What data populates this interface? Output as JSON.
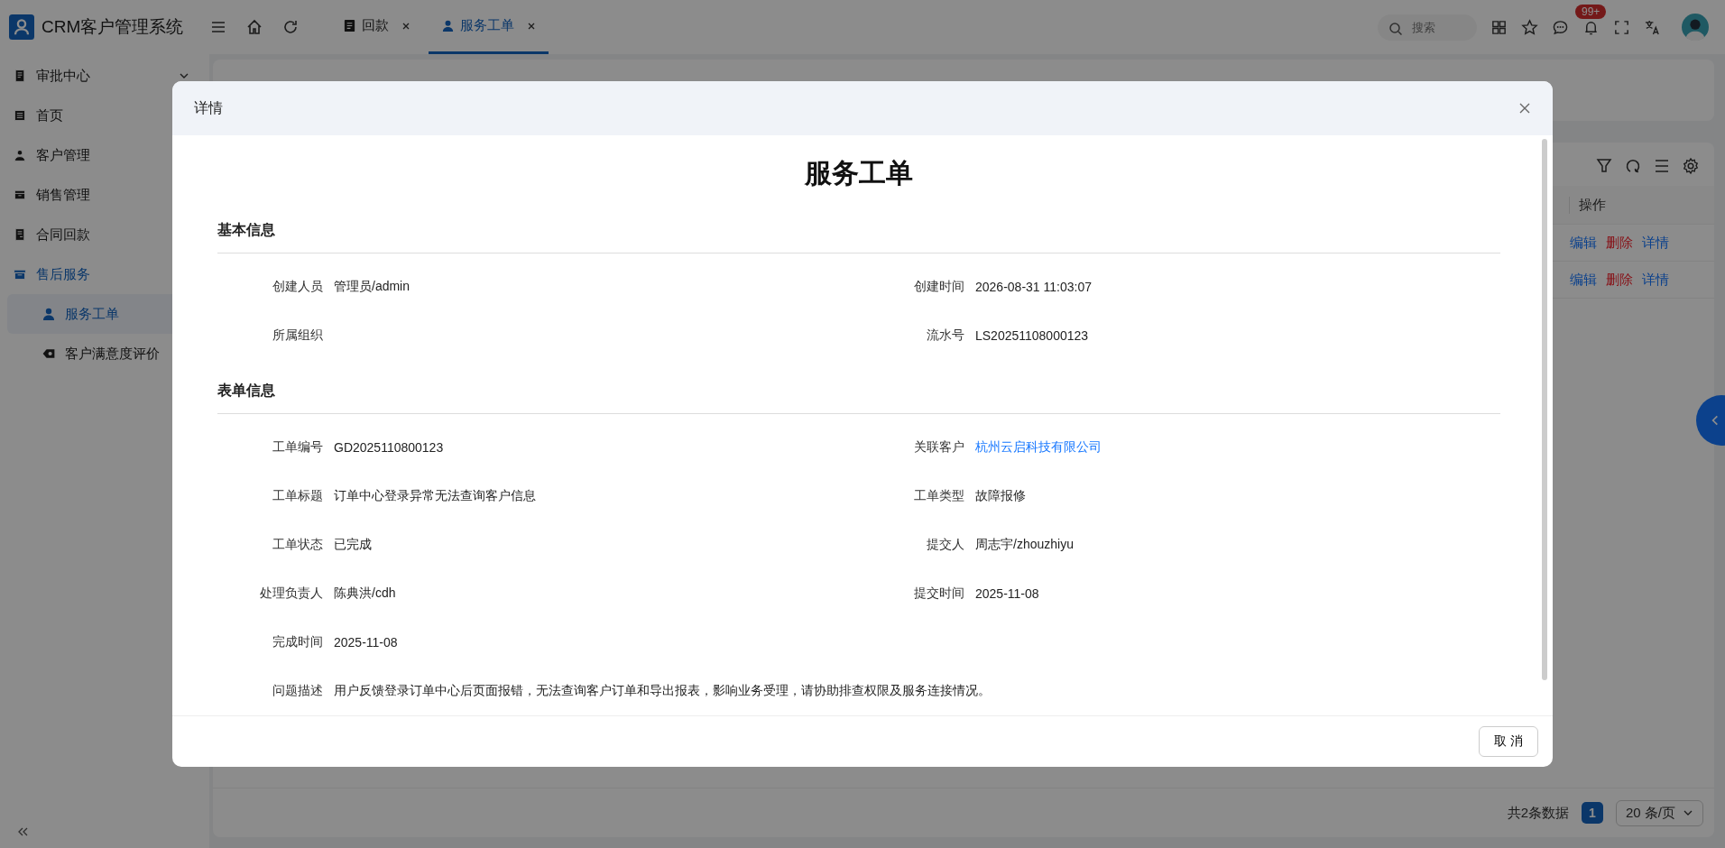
{
  "app": {
    "title": "CRM客户管理系统"
  },
  "tabs": [
    {
      "label": "回款",
      "selected": false
    },
    {
      "label": "服务工单",
      "selected": true
    }
  ],
  "header": {
    "search": {
      "placeholder": "搜索"
    },
    "notification_badge": "99+"
  },
  "sidebar": {
    "items": [
      {
        "label": "审批中心",
        "expanded": false,
        "selected": false
      },
      {
        "label": "首页",
        "selected": false
      },
      {
        "label": "客户管理",
        "selected": false
      },
      {
        "label": "销售管理",
        "selected": false
      },
      {
        "label": "合同回款",
        "selected": false
      },
      {
        "label": "售后服务",
        "selected": false,
        "children": [
          {
            "label": "服务工单",
            "selected": true
          },
          {
            "label": "客户满意度评价",
            "selected": false
          }
        ]
      }
    ]
  },
  "table": {
    "columns": [
      "操作"
    ],
    "rows": [
      {
        "actions": [
          {
            "label": "编辑",
            "kind": "normal"
          },
          {
            "label": "删除",
            "kind": "danger"
          },
          {
            "label": "详情",
            "kind": "normal"
          }
        ]
      },
      {
        "actions": [
          {
            "label": "编辑",
            "kind": "normal"
          },
          {
            "label": "删除",
            "kind": "danger"
          },
          {
            "label": "详情",
            "kind": "normal"
          }
        ]
      }
    ]
  },
  "pagination": {
    "total": "共2条数据",
    "pages": [
      {
        "label": "1",
        "selected": true
      }
    ],
    "page_size": "20 条/页"
  },
  "modal": {
    "title": "详情",
    "doc_title": "服务工单",
    "sections": [
      {
        "title": "基本信息",
        "fields": [
          {
            "label": "创建人员",
            "value": "管理员/admin",
            "kind": "text"
          },
          {
            "label": "创建时间",
            "value": "2026-08-31 11:03:07",
            "kind": "text"
          },
          {
            "label": "所属组织",
            "kind": "text"
          },
          {
            "label": "流水号",
            "value": "LS20251108000123",
            "kind": "text"
          }
        ]
      },
      {
        "title": "表单信息",
        "fields": [
          {
            "label": "工单编号",
            "value": "GD2025110800123",
            "kind": "text"
          },
          {
            "label": "关联客户",
            "value": "杭州云启科技有限公司",
            "kind": "link"
          },
          {
            "label": "工单标题",
            "value": "订单中心登录异常无法查询客户信息",
            "kind": "text"
          },
          {
            "label": "工单类型",
            "value": "故障报修",
            "kind": "text"
          },
          {
            "label": "工单状态",
            "value": "已完成",
            "kind": "text"
          },
          {
            "label": "提交人",
            "value": "周志宇/zhouzhiyu",
            "kind": "text"
          },
          {
            "label": "处理负责人",
            "value": "陈典洪/cdh",
            "kind": "text"
          },
          {
            "label": "提交时间",
            "value": "2025-11-08",
            "kind": "text"
          },
          {
            "label": "完成时间",
            "value": "2025-11-08",
            "kind": "text"
          },
          {
            "label": "问题描述",
            "value": "用户反馈登录订单中心后页面报错，无法查询客户订单和导出报表，影响业务受理，请协助排查权限及服务连接情况。",
            "kind": "wide"
          }
        ]
      }
    ],
    "buttons": [
      "取 消"
    ]
  }
}
